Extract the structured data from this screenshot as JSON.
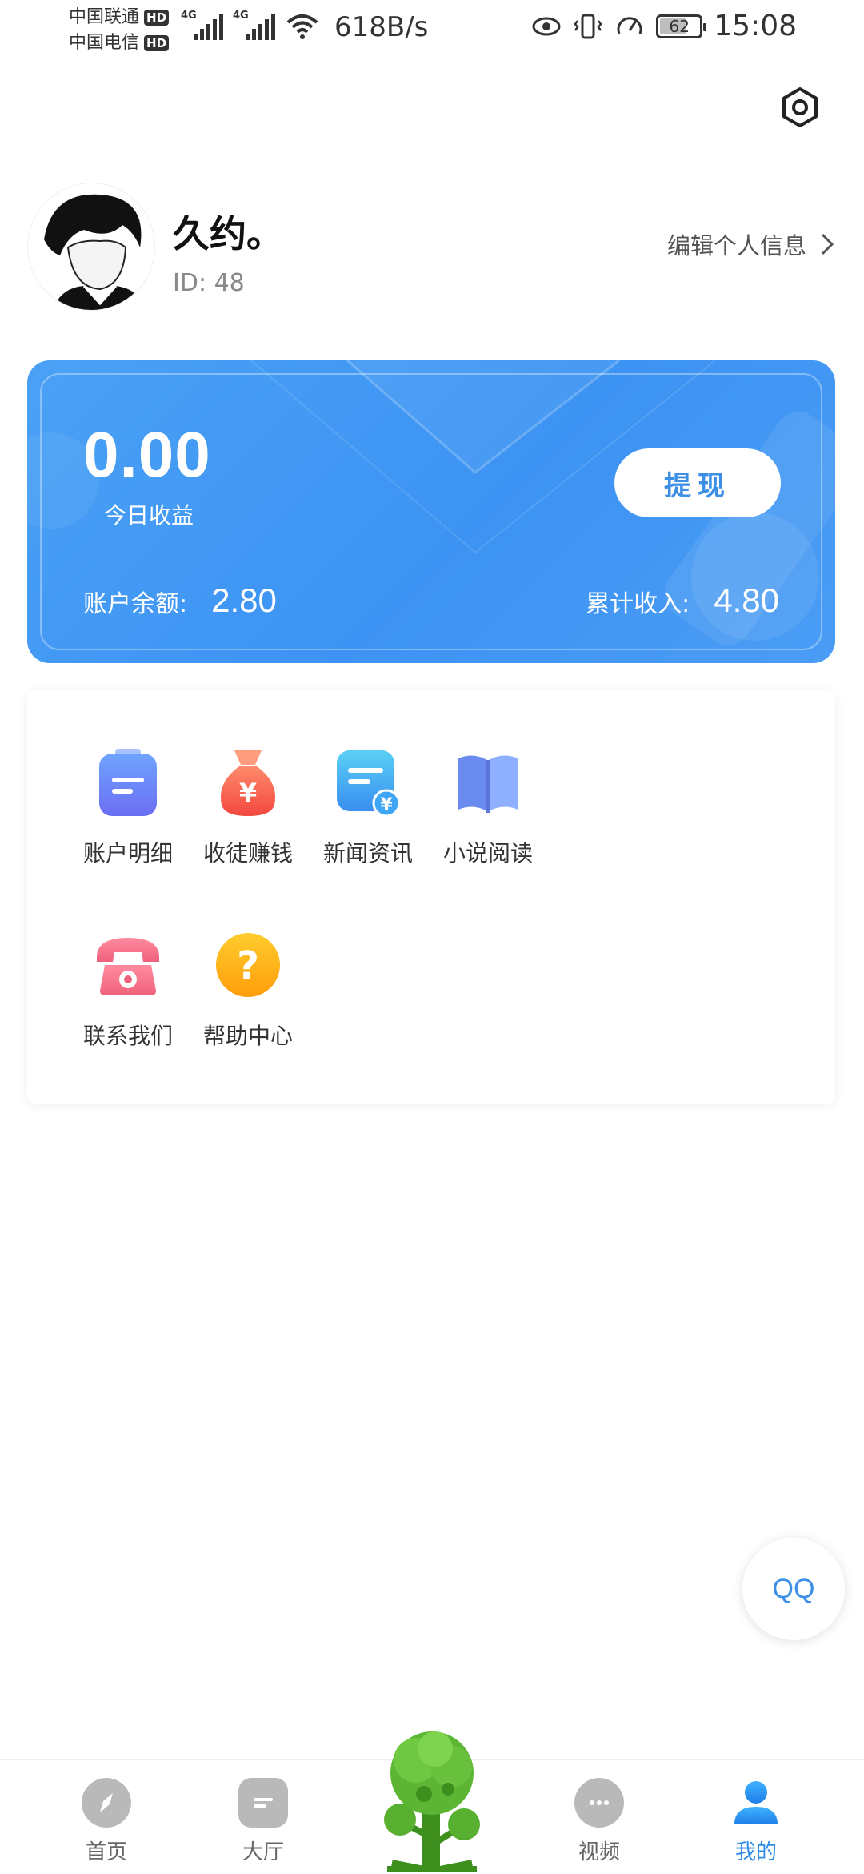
{
  "status_bar": {
    "carrier1": "中国联通",
    "carrier2": "中国电信",
    "hd": "HD",
    "net_type": "4G",
    "net_speed": "618B/s",
    "battery": "62",
    "time": "15:08"
  },
  "profile": {
    "name": "久约。",
    "id_text": "ID: 48",
    "edit_label": "编辑个人信息"
  },
  "earnings": {
    "today_value": "0.00",
    "today_label": "今日收益",
    "withdraw_label": "提现",
    "balance_label": "账户余额:",
    "balance_value": "2.80",
    "total_label": "累计收入:",
    "total_value": "4.80"
  },
  "menu": {
    "items": [
      {
        "label": "账户明细",
        "icon": "account-detail-icon"
      },
      {
        "label": "收徒赚钱",
        "icon": "money-bag-icon"
      },
      {
        "label": "新闻资讯",
        "icon": "news-icon"
      },
      {
        "label": "小说阅读",
        "icon": "book-icon"
      },
      {
        "label": "联系我们",
        "icon": "phone-icon"
      },
      {
        "label": "帮助中心",
        "icon": "help-icon"
      }
    ]
  },
  "qq_label": "QQ",
  "nav": {
    "items": [
      {
        "label": "首页",
        "icon": "compass-icon"
      },
      {
        "label": "大厅",
        "icon": "hall-icon"
      },
      {
        "label": "视频",
        "icon": "chat-bubble-icon"
      },
      {
        "label": "我的",
        "icon": "user-icon"
      }
    ],
    "active": "我的"
  },
  "colors": {
    "accent": "#3b8fe6",
    "card_gradient_start": "#4aa1f5",
    "card_gradient_end": "#3d93f3"
  }
}
